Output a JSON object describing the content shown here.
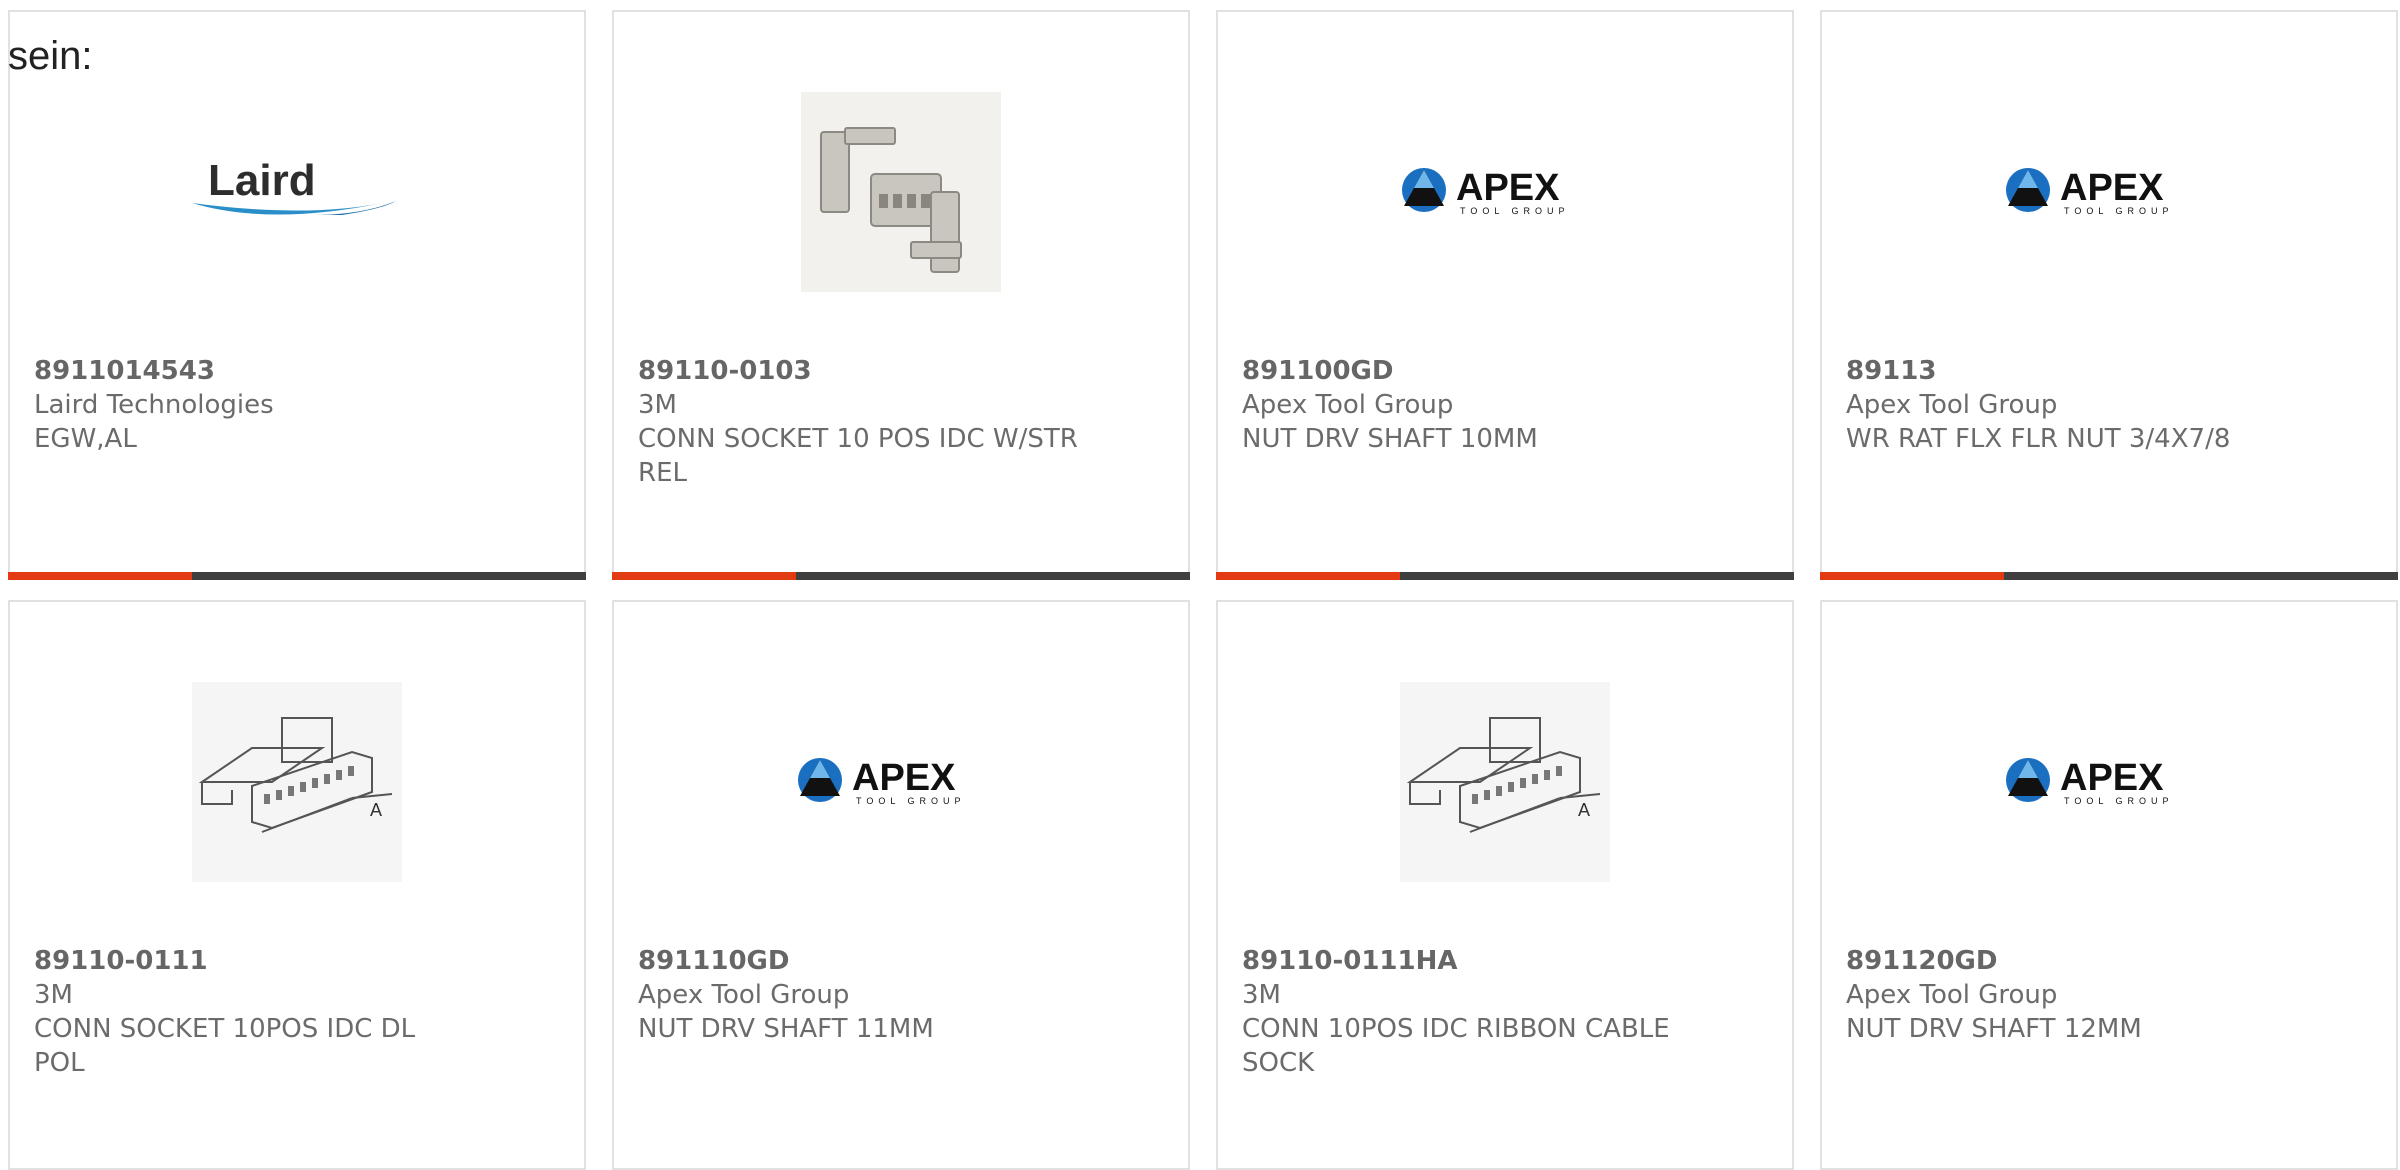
{
  "intro_text": "sein:",
  "colors": {
    "card_border": "#e1e1e1",
    "text": "#6b6b6b",
    "bar_dark": "#3f3f3f",
    "bar_accent": "#e23a12",
    "apex_blue": "#1a6fc1"
  },
  "products": [
    {
      "part_number": "8911014543",
      "manufacturer": "Laird Technologies",
      "description": "EGW,AL",
      "image": "laird-logo",
      "logo_text": "Laird"
    },
    {
      "part_number": "89110-0103",
      "manufacturer": "3M",
      "description": "CONN SOCKET 10 POS IDC W/STR REL",
      "image": "connector-socket-photo"
    },
    {
      "part_number": "891100GD",
      "manufacturer": "Apex Tool Group",
      "description": "NUT DRV SHAFT 10MM",
      "image": "apex-logo",
      "logo_text": "APEX",
      "logo_subtext": "TOOL GROUP"
    },
    {
      "part_number": "89113",
      "manufacturer": "Apex Tool Group",
      "description": "WR RAT FLX FLR NUT 3/4X7/8",
      "image": "apex-logo",
      "logo_text": "APEX",
      "logo_subtext": "TOOL GROUP"
    },
    {
      "part_number": "89110-0111",
      "manufacturer": "3M",
      "description": "CONN SOCKET 10POS IDC DL POL",
      "image": "connector-drawing",
      "drawing_label": "A"
    },
    {
      "part_number": "891110GD",
      "manufacturer": "Apex Tool Group",
      "description": "NUT DRV SHAFT 11MM",
      "image": "apex-logo",
      "logo_text": "APEX",
      "logo_subtext": "TOOL GROUP"
    },
    {
      "part_number": "89110-0111HA",
      "manufacturer": "3M",
      "description": "CONN 10POS IDC RIBBON CABLE SOCK",
      "image": "connector-drawing",
      "drawing_label": "A"
    },
    {
      "part_number": "891120GD",
      "manufacturer": "Apex Tool Group",
      "description": "NUT DRV SHAFT 12MM",
      "image": "apex-logo",
      "logo_text": "APEX",
      "logo_subtext": "TOOL GROUP"
    }
  ]
}
